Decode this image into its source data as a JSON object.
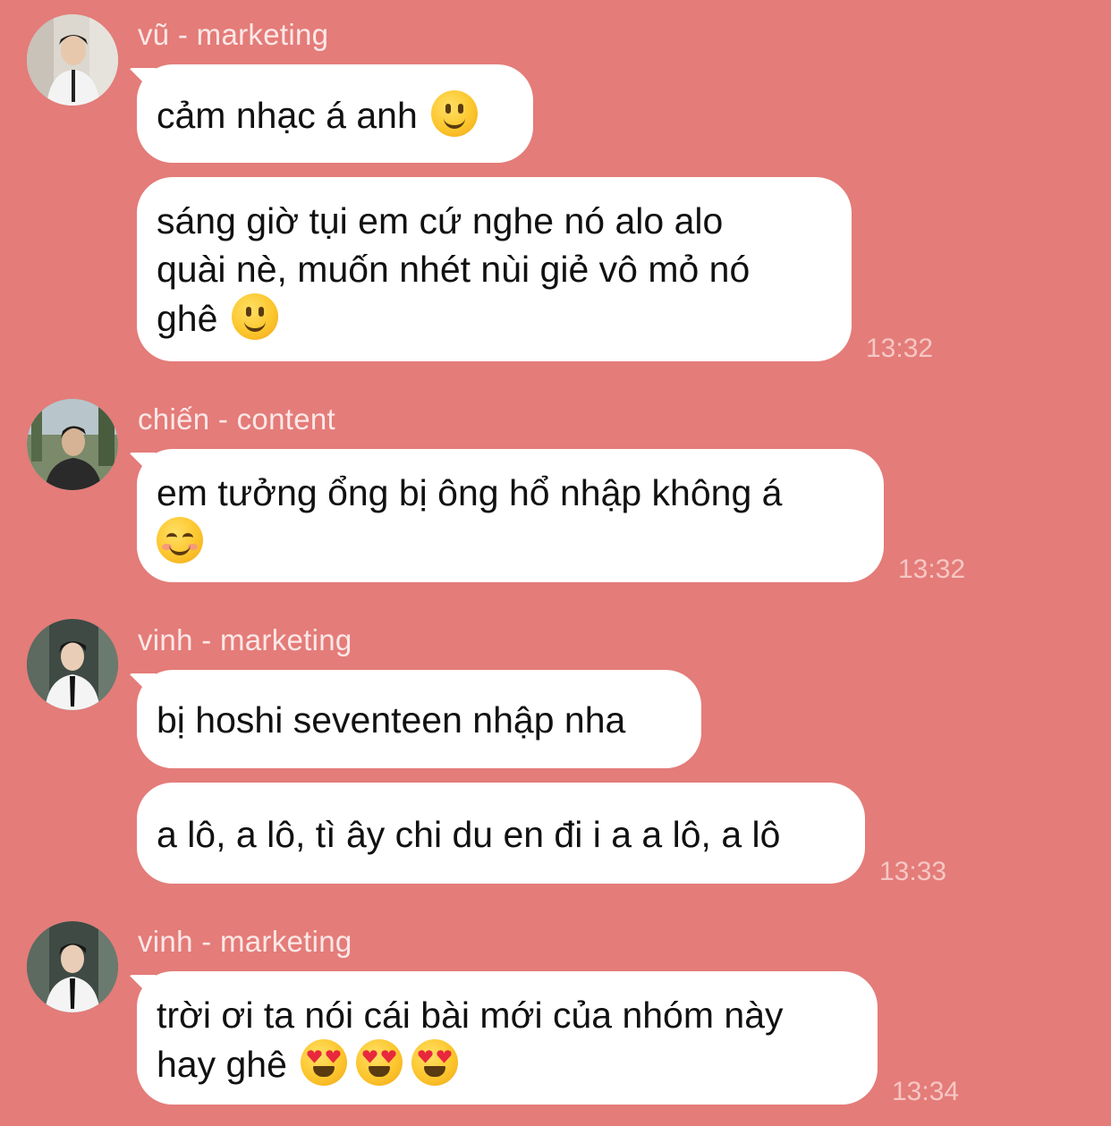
{
  "chat": {
    "groups": [
      {
        "sender": "vũ - marketing",
        "avatar_icon": "avatar-photo-vu",
        "messages": [
          {
            "lines": [
              "cảm nhạc á anh"
            ],
            "emoji": "slightly-smiling-face"
          },
          {
            "lines": [
              "sáng giờ tụi em cứ nghe nó alo alo",
              "quài nè, muốn nhét nùi giẻ vô mỏ nó",
              "ghê"
            ],
            "emoji": "slightly-smiling-face"
          }
        ],
        "time": "13:32"
      },
      {
        "sender": "chiến - content",
        "avatar_icon": "avatar-photo-chien",
        "messages": [
          {
            "lines": [
              "em tưởng ổng bị ông hổ nhập không á"
            ],
            "emoji": "smiling-face"
          }
        ],
        "time": "13:32"
      },
      {
        "sender": "vinh - marketing",
        "avatar_icon": "avatar-photo-vinh",
        "messages": [
          {
            "lines": [
              "bị hoshi seventeen nhập nha"
            ]
          },
          {
            "lines": [
              "a lô, a lô, tì ây chi du en đi i a a lô, a lô"
            ]
          }
        ],
        "time": "13:33"
      },
      {
        "sender": "vinh - marketing",
        "avatar_icon": "avatar-photo-vinh",
        "messages": [
          {
            "lines": [
              "trời ơi ta nói cái bài mới của nhóm này",
              "hay ghê"
            ],
            "emoji": "heart-eyes-face x3"
          }
        ],
        "time": "13:34"
      }
    ]
  },
  "colors": {
    "background": "#e47c79",
    "bubble": "#ffffff",
    "sender_text": "#fbe8e7",
    "timestamp_text": "#f6c7c4"
  }
}
